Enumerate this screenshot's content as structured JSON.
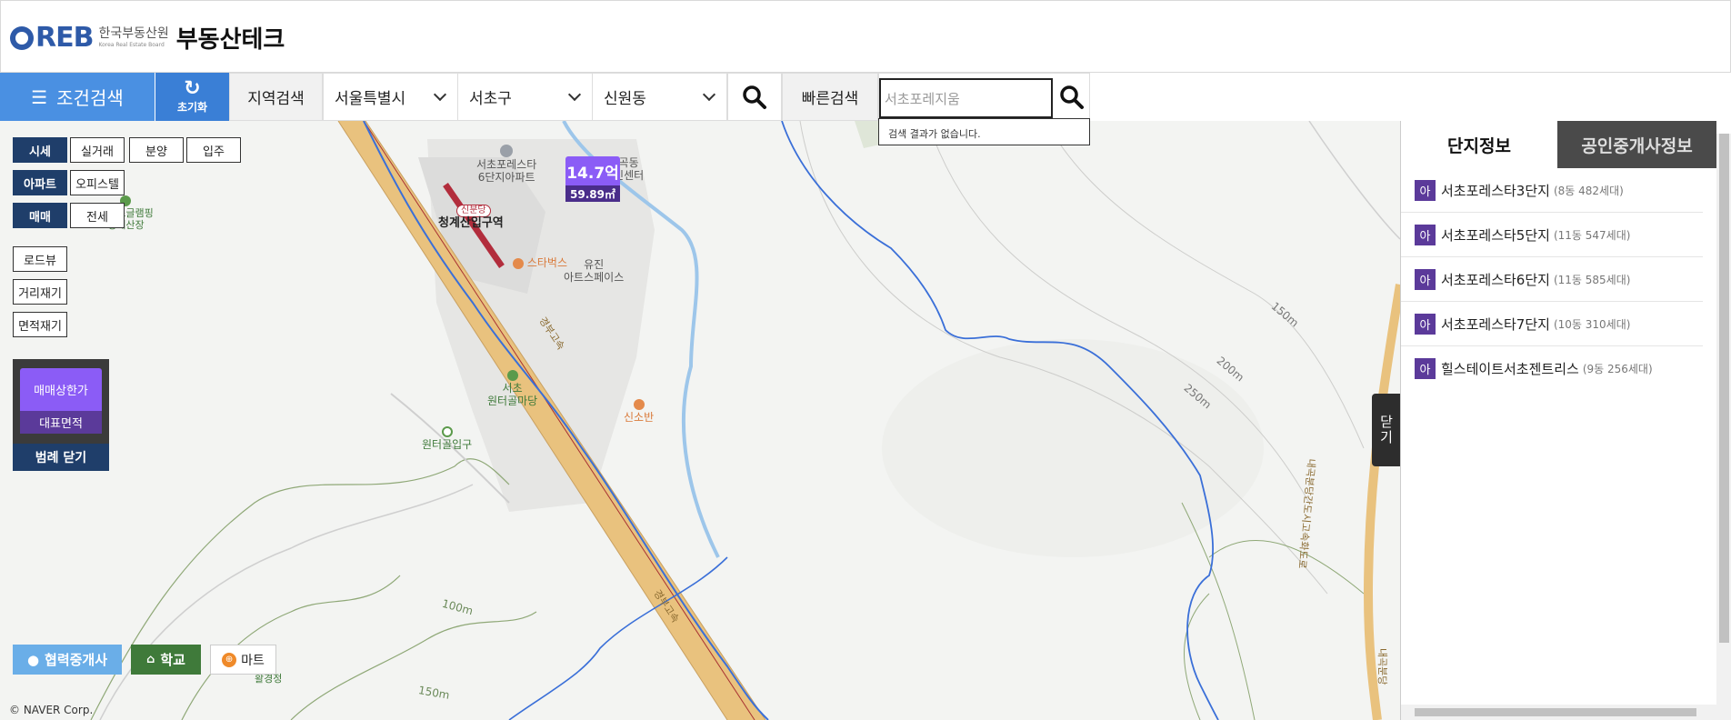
{
  "header": {
    "logo_mark": "REB",
    "org_ko": "한국부동산원",
    "org_en": "Korea Real Estate Board",
    "service_name": "부동산테크"
  },
  "searchbar": {
    "condition_search": "조건검색",
    "reset": "초기화",
    "region_search_label": "지역검색",
    "city": "서울특별시",
    "district": "서초구",
    "dong": "신원동",
    "quick_search_label": "빠른검색",
    "quick_search_value": "서초포레지움",
    "quick_search_result": "검색 결과가 없습니다."
  },
  "map_tools": {
    "row1": [
      "시세",
      "실거래",
      "분양",
      "입주"
    ],
    "row2": [
      "아파트",
      "오피스텔"
    ],
    "row3": [
      "매매",
      "전세"
    ],
    "roadview": "로드뷰",
    "distance": "거리재기",
    "area": "면적재기",
    "legend_price": "매매상한가",
    "legend_area": "대표면적",
    "legend_close": "범례 닫기"
  },
  "price_marker": {
    "price": "14.7억",
    "area": "59.89㎡"
  },
  "map_labels": {
    "apt6": "서초포레스타\n6단지아파트",
    "center": "내곡동\n주민센터",
    "station_badge": "신분당",
    "station": "청계산입구역",
    "starbucks": "스타벅스",
    "yujin": "유진\n아트스페이스",
    "glamping": "울서초글램핑\n청계산장",
    "madang": "서초\n원터골마당",
    "wonter_entrance": "원터골입구",
    "sinsoban": "신소반",
    "gyeongbu1": "경부고속",
    "gyeongbu2": "경부고속",
    "pavilion": "활경정",
    "c100": "100m",
    "c150a": "150m",
    "c150b": "150m",
    "c200": "200m",
    "c250": "250m",
    "road_right": "내곡분당간도시고속화도로",
    "road_right2": "내곡분당"
  },
  "bottom_buttons": {
    "agent": "협력중개사",
    "school": "학교",
    "mart": "마트"
  },
  "copyright": "© NAVER Corp.",
  "panel": {
    "close": "닫기",
    "tab_complex": "단지정보",
    "tab_agents": "공인중개사정보",
    "badge": "아",
    "complexes": [
      {
        "name": "서초포레스타3단지",
        "meta": "(8동 482세대)"
      },
      {
        "name": "서초포레스타5단지",
        "meta": "(11동 547세대)"
      },
      {
        "name": "서초포레스타6단지",
        "meta": "(11동 585세대)"
      },
      {
        "name": "서초포레스타7단지",
        "meta": "(10동 310세대)"
      },
      {
        "name": "힐스테이트서초젠트리스",
        "meta": "(9동 256세대)"
      }
    ]
  },
  "colors": {
    "accent_blue": "#4a90e2",
    "navy": "#1f3e6a",
    "purple": "#8b5cf6",
    "dark_purple": "#5b3a9a",
    "school_green": "#3f7a3a"
  }
}
